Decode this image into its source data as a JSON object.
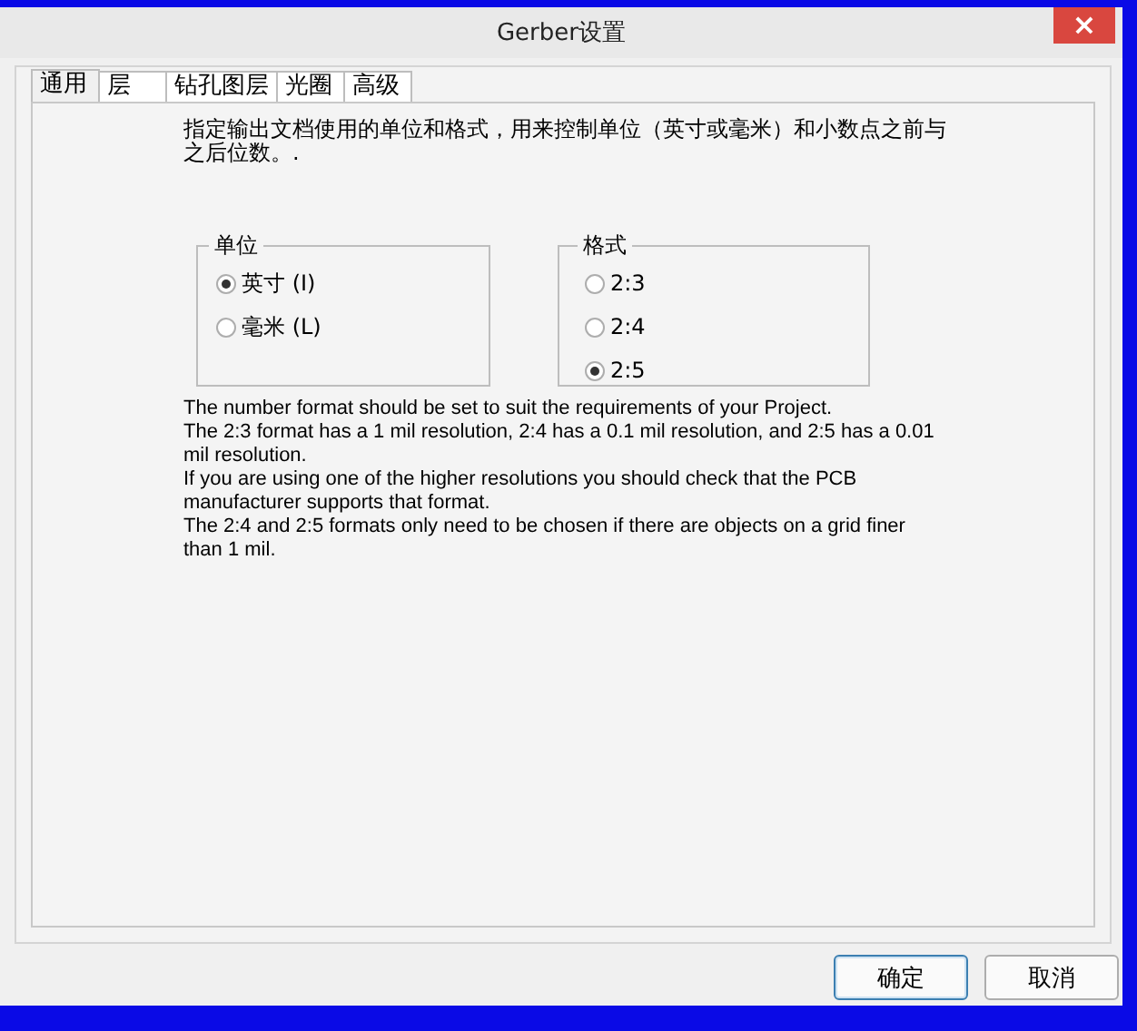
{
  "window": {
    "title": "Gerber设置",
    "close": "×"
  },
  "tabs": [
    {
      "label": "通用",
      "selected": true
    },
    {
      "label": "层",
      "selected": false
    },
    {
      "label": "钻孔图层",
      "selected": false
    },
    {
      "label": "光圈",
      "selected": false
    },
    {
      "label": "高级",
      "selected": false
    }
  ],
  "description": "指定输出文档使用的单位和格式，用来控制单位（英寸或毫米）和小数点之前与之后位数。.",
  "groups": [
    {
      "title": "单位",
      "options": [
        {
          "label": "英寸 (I)",
          "selected": true
        },
        {
          "label": "毫米 (L)",
          "selected": false
        }
      ]
    },
    {
      "title": "格式",
      "options": [
        {
          "label": "2:3",
          "selected": false
        },
        {
          "label": "2:4",
          "selected": false
        },
        {
          "label": "2:5",
          "selected": true
        }
      ]
    }
  ],
  "notes": [
    "The number format should be set to suit the requirements of your Project.",
    "The 2:3 format has a 1 mil resolution, 2:4 has a 0.1 mil resolution, and 2:5 has a 0.01 mil resolution.",
    "If you are using one of the higher resolutions you should check that the PCB manufacturer supports that format.",
    "The 2:4 and 2:5 formats only need to be chosen if there are objects on a grid finer than 1 mil."
  ],
  "buttons": [
    {
      "label": "确定",
      "default": true
    },
    {
      "label": "取消",
      "default": false
    }
  ]
}
